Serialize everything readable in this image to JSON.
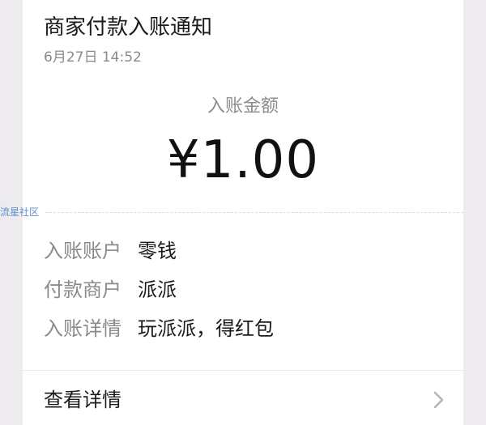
{
  "notification": {
    "title": "商家付款入账通知",
    "time": "6月27日  14:52",
    "amount_label": "入账金额",
    "amount": "¥1.00",
    "watermark": "流星社区",
    "details": [
      {
        "key": "入账账户",
        "value": "零钱"
      },
      {
        "key": "付款商户",
        "value": "派派"
      },
      {
        "key": "入账详情",
        "value": "玩派派，得红包"
      }
    ],
    "view_details_label": "查看详情",
    "icons": {
      "more": "chevron-right-icon"
    }
  },
  "colors": {
    "background": "#edebee",
    "card": "#ffffff",
    "primary_text": "#1a1a1a",
    "secondary_text": "#8a8a8a",
    "watermark": "#5b8fd0"
  }
}
